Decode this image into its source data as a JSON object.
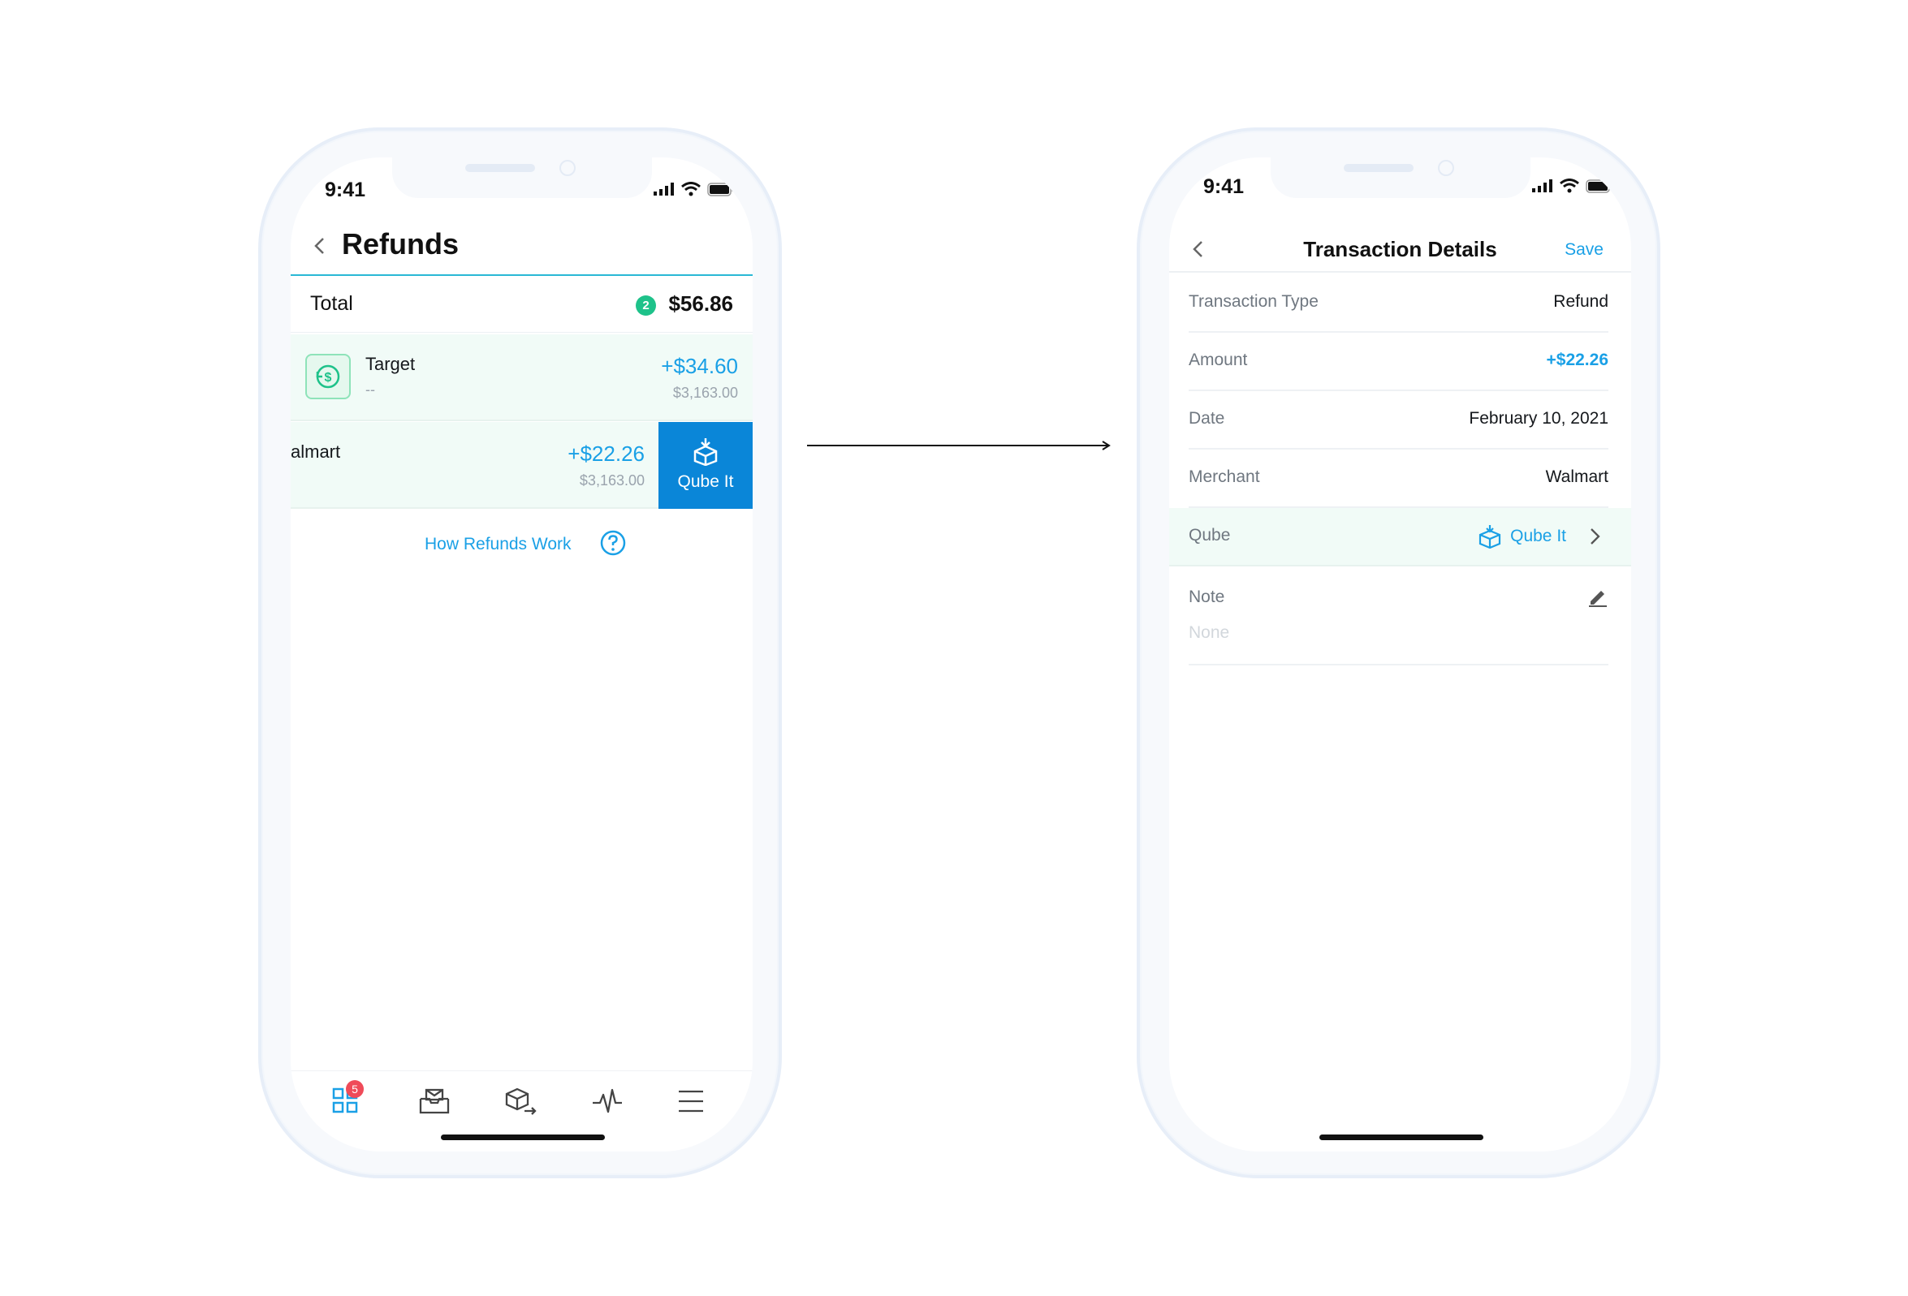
{
  "left_phone": {
    "status": {
      "time": "9:41"
    },
    "header": {
      "title": "Refunds"
    },
    "total": {
      "label": "Total",
      "count": "2",
      "value": "$56.86"
    },
    "transactions": [
      {
        "merchant": "Target",
        "sub": "--",
        "amount": "+$34.60",
        "balance": "$3,163.00"
      },
      {
        "merchant": "almart",
        "amount": "+$22.26",
        "balance": "$3,163.00",
        "swipe_action": "Qube It"
      }
    ],
    "help_link": "How Refunds Work",
    "tabbar": {
      "badge": "5",
      "icons": [
        "grid-icon",
        "inbox-icon",
        "qube-send-icon",
        "activity-icon",
        "menu-icon"
      ]
    }
  },
  "right_phone": {
    "status": {
      "time": "9:41"
    },
    "header": {
      "title": "Transaction Details",
      "save": "Save"
    },
    "rows": [
      {
        "label": "Transaction Type",
        "value": "Refund"
      },
      {
        "label": "Amount",
        "value": "+$22.26"
      },
      {
        "label": "Date",
        "value": "February 10, 2021"
      },
      {
        "label": "Merchant",
        "value": "Walmart"
      }
    ],
    "qube": {
      "label": "Qube",
      "link": "Qube It"
    },
    "note": {
      "label": "Note",
      "value": "None"
    }
  },
  "colors": {
    "accent_blue": "#1aa0e6",
    "swipe_blue": "#0a86d8",
    "green_badge": "#1ec28a",
    "highlight_row": "#f1fbf7",
    "badge_red": "#ef4b59"
  }
}
